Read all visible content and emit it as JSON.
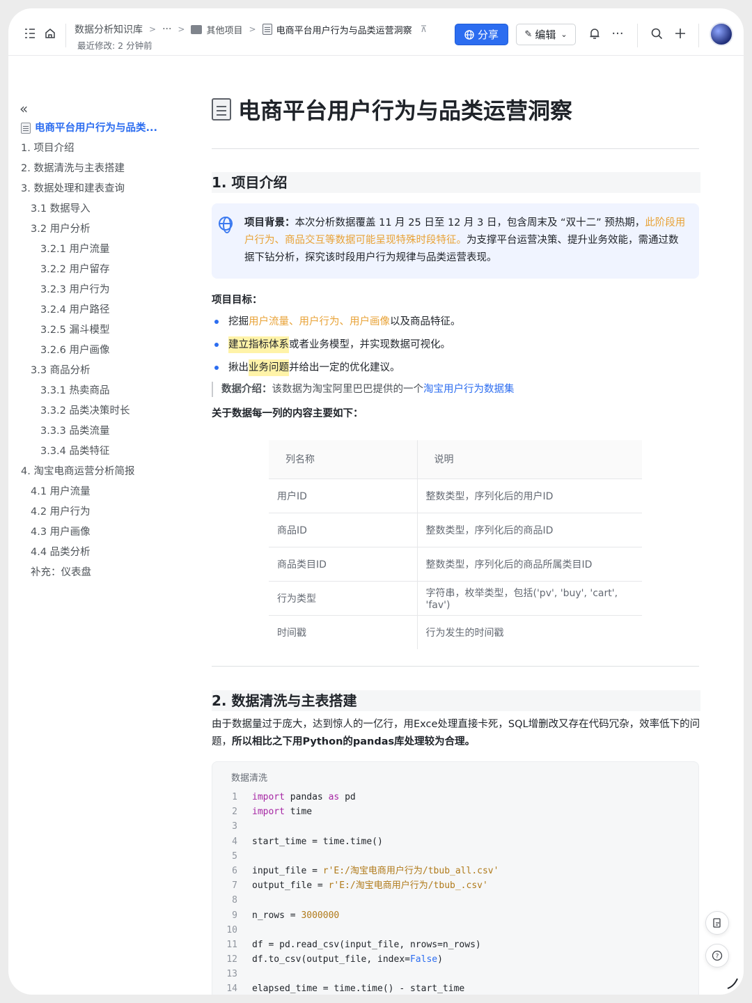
{
  "topbar": {
    "breadcrumb_root": "数据分析知识库",
    "breadcrumb_more": "···",
    "breadcrumb_folder": "其他项目",
    "breadcrumb_current": "电商平台用户行为与品类运营洞察",
    "last_modified": "最近修改: 2 分钟前",
    "share_label": "分享",
    "edit_label": "编辑"
  },
  "toc": {
    "items": [
      {
        "label": "电商平台用户行为与品类...",
        "level": 1,
        "active": true
      },
      {
        "label": "1. 项目介绍",
        "level": 1
      },
      {
        "label": "2. 数据清洗与主表搭建",
        "level": 1
      },
      {
        "label": "3. 数据处理和建表查询",
        "level": 1
      },
      {
        "label": "3.1 数据导入",
        "level": 2
      },
      {
        "label": "3.2 用户分析",
        "level": 2
      },
      {
        "label": "3.2.1 用户流量",
        "level": 3
      },
      {
        "label": "3.2.2 用户留存",
        "level": 3
      },
      {
        "label": "3.2.3 用户行为",
        "level": 3
      },
      {
        "label": "3.2.4 用户路径",
        "level": 3
      },
      {
        "label": "3.2.5 漏斗模型",
        "level": 3
      },
      {
        "label": "3.2.6 用户画像",
        "level": 3
      },
      {
        "label": "3.3 商品分析",
        "level": 2
      },
      {
        "label": "3.3.1 热卖商品",
        "level": 3
      },
      {
        "label": "3.3.2 品类决策时长",
        "level": 3
      },
      {
        "label": "3.3.3 品类流量",
        "level": 3
      },
      {
        "label": "3.3.4 品类特征",
        "level": 3
      },
      {
        "label": "4. 淘宝电商运营分析简报",
        "level": 1
      },
      {
        "label": "4.1 用户流量",
        "level": 2
      },
      {
        "label": "4.2 用户行为",
        "level": 2
      },
      {
        "label": "4.3 用户画像",
        "level": 2
      },
      {
        "label": "4.4 品类分析",
        "level": 2
      },
      {
        "label": "补充：仪表盘",
        "level": 2
      }
    ]
  },
  "doc": {
    "title": "电商平台用户行为与品类运营洞察",
    "section1": "1. 项目介绍",
    "callout": {
      "label": "项目背景：",
      "text1": "本次分析数据覆盖 11 月 25 日至 12 月 3 日，包含周末及 “双十二” 预热期，",
      "highlight": "此阶段用户行为、商品交互等数据可能呈现特殊时段特征。",
      "text2": "为支撑平台运营决策、提升业务效能，需通过数据下钻分析，探究该时段用户行为规律与品类运营表现。"
    },
    "goals_title": "项目目标：",
    "goal1": {
      "pre": "挖掘",
      "orange": "用户流量、用户行为、用户画像",
      "post": "以及商品特征。"
    },
    "goal2": {
      "hl": "建立指标体系",
      "post": "或者业务模型，并实现数据可视化。"
    },
    "goal3": {
      "pre": "揪出",
      "hl": "业务问题",
      "post": "并给出一定的优化建议。"
    },
    "data_intro": {
      "label": "数据介绍：",
      "text": "该数据为淘宝阿里巴巴提供的一个",
      "link": "淘宝用户行为数据集"
    },
    "columns_title": "关于数据每一列的内容主要如下：",
    "table": {
      "headers": [
        "列名称",
        "说明"
      ],
      "rows": [
        [
          "用户ID",
          "整数类型，序列化后的用户ID"
        ],
        [
          "商品ID",
          "整数类型，序列化后的商品ID"
        ],
        [
          "商品类目ID",
          "整数类型，序列化后的商品所属类目ID"
        ],
        [
          "行为类型",
          "字符串，枚举类型，包括('pv', 'buy', 'cart', 'fav')"
        ],
        [
          "时间戳",
          "行为发生的时间戳"
        ]
      ]
    },
    "section2": "2. 数据清洗与主表搭建",
    "para2": {
      "text": "由于数据量过于庞大，达到惊人的一亿行，用Exce处理直接卡死，SQL增删改又存在代码冗杂，效率低下的问题，",
      "bold": "所以相比之下用Python的pandas库处理较为合理。"
    },
    "code": {
      "title": "数据清洗",
      "lines": [
        {
          "n": "1",
          "parts": [
            [
              "kw",
              "import"
            ],
            [
              "",
              " pandas "
            ],
            [
              "kw",
              "as"
            ],
            [
              "",
              " pd"
            ]
          ]
        },
        {
          "n": "2",
          "parts": [
            [
              "kw",
              "import"
            ],
            [
              "",
              " time"
            ]
          ]
        },
        {
          "n": "3",
          "parts": []
        },
        {
          "n": "4",
          "parts": [
            [
              "",
              "start_time = time.time()"
            ]
          ]
        },
        {
          "n": "5",
          "parts": []
        },
        {
          "n": "6",
          "parts": [
            [
              "",
              "input_file = "
            ],
            [
              "str",
              "r'E:/淘宝电商用户行为/tbub_all.csv'"
            ]
          ]
        },
        {
          "n": "7",
          "parts": [
            [
              "",
              "output_file = "
            ],
            [
              "str",
              "r'E:/淘宝电商用户行为/tbub_.csv'"
            ]
          ]
        },
        {
          "n": "8",
          "parts": []
        },
        {
          "n": "9",
          "parts": [
            [
              "",
              "n_rows = "
            ],
            [
              "num",
              "3000000"
            ]
          ]
        },
        {
          "n": "10",
          "parts": []
        },
        {
          "n": "11",
          "parts": [
            [
              "",
              "df = pd.read_csv(input_file, nrows=n_rows)"
            ]
          ]
        },
        {
          "n": "12",
          "parts": [
            [
              "",
              "df.to_csv(output_file, index="
            ],
            [
              "bool",
              "False"
            ],
            [
              "",
              ")"
            ]
          ]
        },
        {
          "n": "13",
          "parts": []
        },
        {
          "n": "14",
          "parts": [
            [
              "",
              "elapsed_time = time.time() - start_time"
            ]
          ]
        }
      ]
    }
  }
}
